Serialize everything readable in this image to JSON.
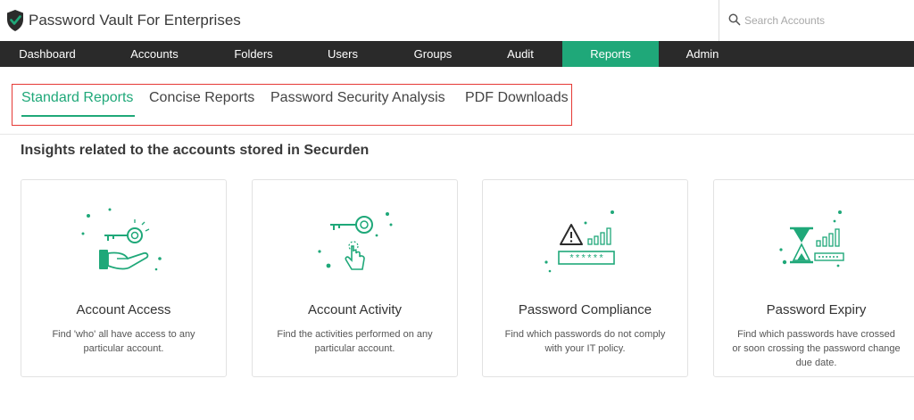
{
  "app": {
    "title": "Password Vault For Enterprises"
  },
  "search": {
    "placeholder": "Search Accounts",
    "value": ""
  },
  "nav": {
    "items": [
      {
        "label": "Dashboard",
        "active": false
      },
      {
        "label": "Accounts",
        "active": false
      },
      {
        "label": "Folders",
        "active": false
      },
      {
        "label": "Users",
        "active": false
      },
      {
        "label": "Groups",
        "active": false
      },
      {
        "label": "Audit",
        "active": false
      },
      {
        "label": "Reports",
        "active": true
      },
      {
        "label": "Admin",
        "active": false
      }
    ]
  },
  "tabs": [
    {
      "label": "Standard Reports",
      "active": true
    },
    {
      "label": "Concise Reports",
      "active": false
    },
    {
      "label": "Password Security Analysis",
      "active": false
    },
    {
      "label": "PDF Downloads",
      "active": false
    }
  ],
  "section": {
    "heading": "Insights related to the accounts stored in Securden"
  },
  "cards": [
    {
      "icon": "key-in-hand-icon",
      "title": "Account Access",
      "description": "Find 'who' all have access to any particular account."
    },
    {
      "icon": "key-click-icon",
      "title": "Account Activity",
      "description": "Find the activities performed on any particular account."
    },
    {
      "icon": "warning-password-icon",
      "title": "Password Compliance",
      "description": "Find which passwords do not comply with your IT policy."
    },
    {
      "icon": "hourglass-icon",
      "title": "Password Expiry",
      "description": "Find which passwords have crossed or soon crossing the password change due date."
    }
  ],
  "colors": {
    "accent": "#1fa879",
    "nav_bg": "#2a2a2a",
    "highlight_border": "#e53935"
  },
  "illustration_text": {
    "password_mask": "******"
  }
}
